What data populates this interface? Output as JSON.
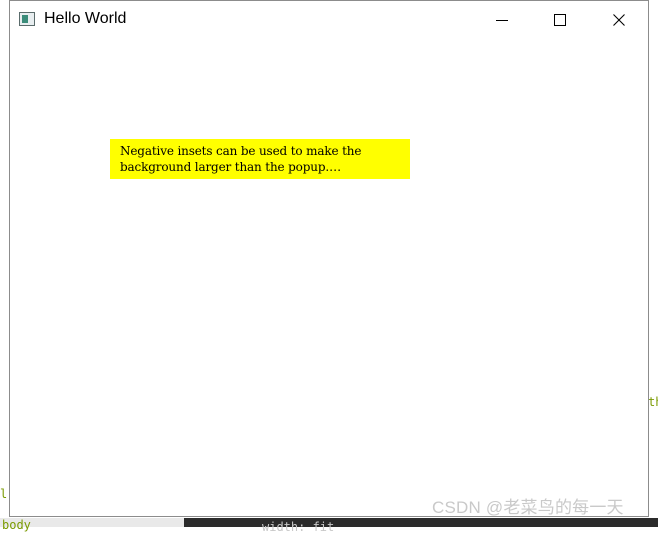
{
  "window": {
    "title": "Hello World",
    "icon": "app-window-icon",
    "controls": {
      "minimize_icon": "minimize-icon",
      "maximize_icon": "maximize-icon",
      "close_icon": "close-icon"
    }
  },
  "popup": {
    "background_color": "#ffff00",
    "line1": "Negative insets can be used to make the",
    "line2": "background larger than the popup.…"
  },
  "background": {
    "code_left": "l",
    "code_body": "body",
    "code_right": "th",
    "code_dark": "width: fit"
  },
  "watermark": {
    "text": "CSDN @老菜鸟的每一天"
  }
}
